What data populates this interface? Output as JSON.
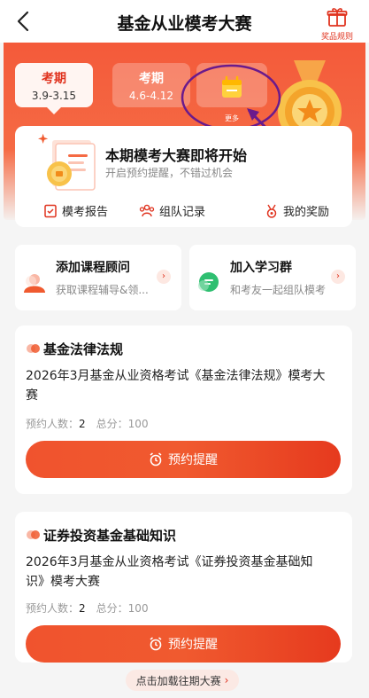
{
  "header": {
    "title": "基金从业模考大赛",
    "rules_label": "奖品规则"
  },
  "colors": {
    "accent": "#e0331f",
    "hero_top": "#f45a3a",
    "annotation": "#6a1a8c"
  },
  "period_tabs": [
    {
      "name": "考期",
      "date": "3.9-3.15",
      "selected": true
    },
    {
      "name": "考期",
      "date": "4.6-4.12",
      "selected": false
    }
  ],
  "more_tab": {
    "label": "更多",
    "icon": "calendar-icon"
  },
  "notice_card": {
    "headline": "本期模考大赛即将开始",
    "subline": "开启预约提醒，不错过机会",
    "links": [
      {
        "label": "模考报告",
        "icon": "report-icon"
      },
      {
        "label": "组队记录",
        "icon": "team-icon"
      },
      {
        "label": "我的奖励",
        "icon": "medal-icon"
      }
    ]
  },
  "promo_cards": [
    {
      "title": "添加课程顾问",
      "subtitle": "获取课程辅导&领...",
      "icon": "advisor-icon"
    },
    {
      "title": "加入学习群",
      "subtitle": "和考友一起组队模考",
      "icon": "chat-icon"
    }
  ],
  "exams": [
    {
      "title": "基金法律法规",
      "description": "2026年3月基金从业资格考试《基金法律法规》模考大赛",
      "reserved_label": "预约人数：",
      "reserved_count": "2",
      "total_label": "总分：",
      "total_score": "100",
      "button_label": "预约提醒"
    },
    {
      "title": "证券投资基金基础知识",
      "description": "2026年3月基金从业资格考试《证券投资基金基础知识》模考大赛",
      "reserved_label": "预约人数：",
      "reserved_count": "2",
      "total_label": "总分：",
      "total_score": "100",
      "button_label": "预约提醒"
    }
  ],
  "footer": {
    "load_more_label": "点击加载往期大赛"
  }
}
